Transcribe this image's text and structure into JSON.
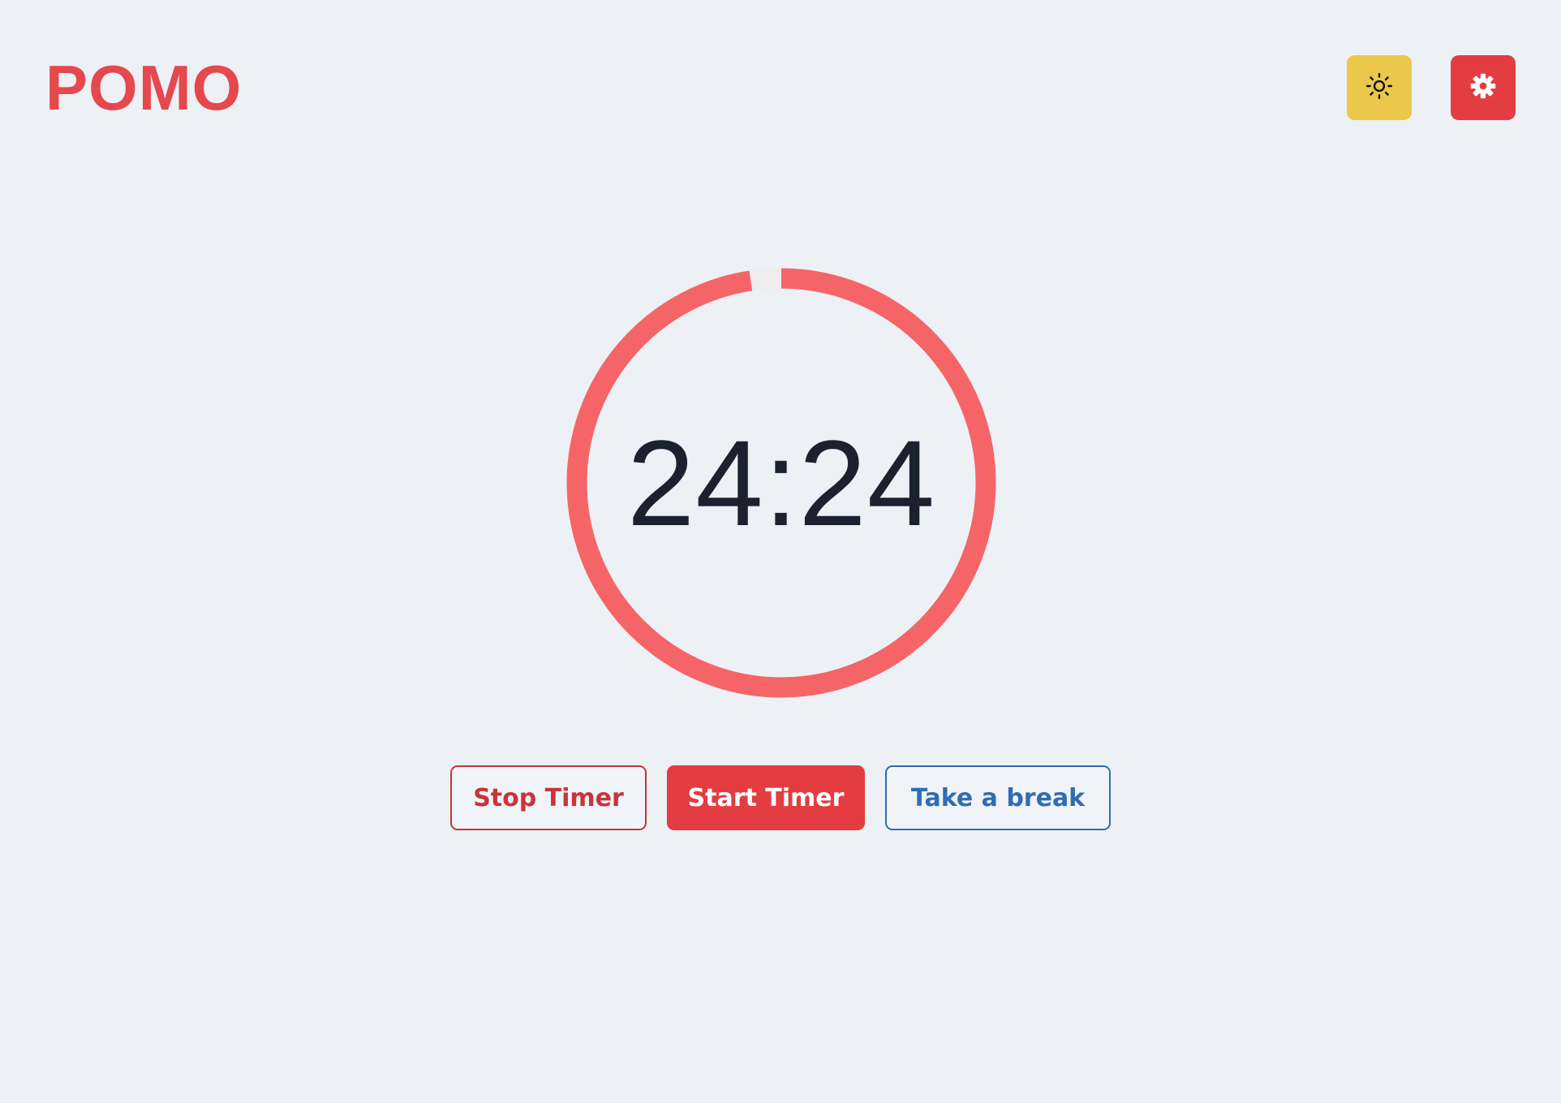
{
  "header": {
    "logo": "POMO",
    "theme_toggle_icon": "sun-icon",
    "settings_icon": "gear-icon"
  },
  "timer": {
    "display": "24:24",
    "progress_fraction": 0.976,
    "ring_color": "#f56568",
    "track_color": "#eeecec"
  },
  "actions": {
    "stop_label": "Stop Timer",
    "start_label": "Start Timer",
    "break_label": "Take a break"
  },
  "colors": {
    "background": "#edf1f6",
    "brand_red": "#e5484d",
    "theme_button": "#ebc74a",
    "settings_button": "#e33d41",
    "break_blue": "#2f6db3"
  }
}
